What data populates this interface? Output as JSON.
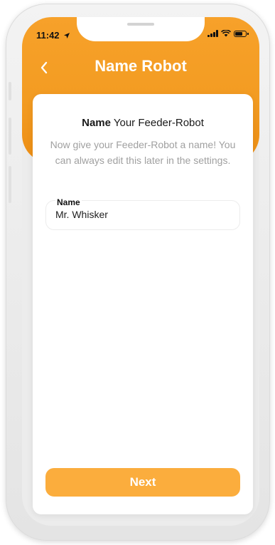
{
  "status_bar": {
    "time": "11:42"
  },
  "header": {
    "title": "Name Robot",
    "back_icon": "chevron-left-icon"
  },
  "card": {
    "heading_bold": "Name",
    "heading_rest": " Your Feeder-Robot",
    "subtitle": "Now give your Feeder-Robot a name! You can always edit this later in the settings."
  },
  "name_field": {
    "label": "Name",
    "value": "Mr. Whisker"
  },
  "next_button": {
    "label": "Next"
  },
  "colors": {
    "accent": "#f39c22",
    "button": "#fbad3d"
  }
}
